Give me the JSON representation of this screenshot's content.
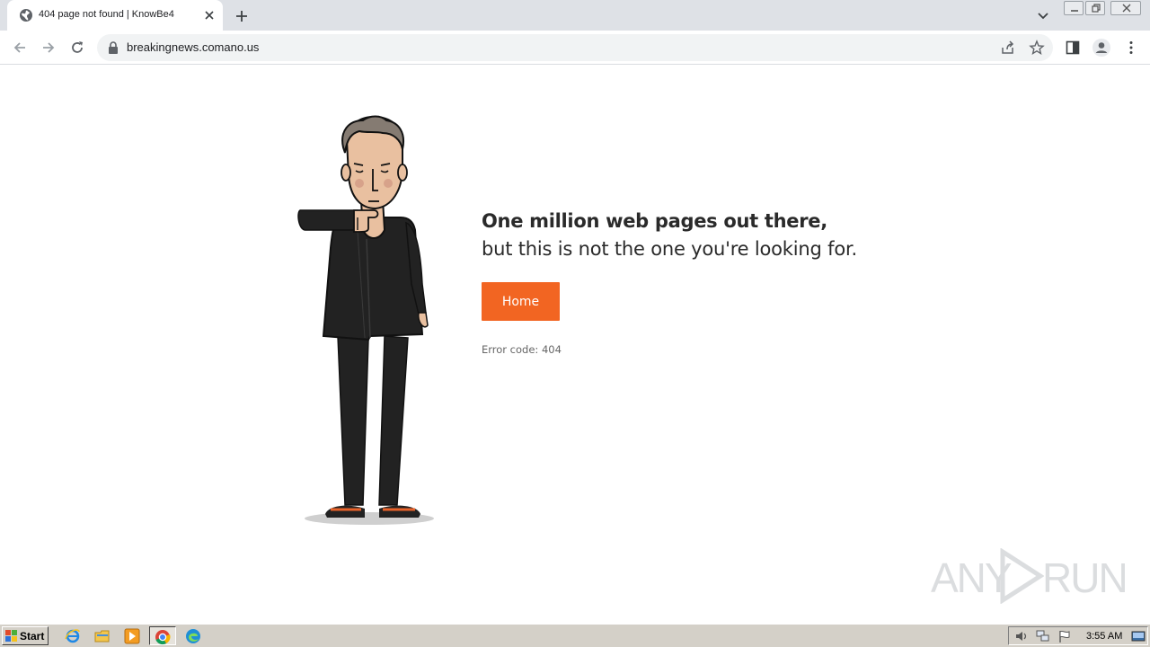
{
  "browser": {
    "tab": {
      "title": "404 page not found | KnowBe4"
    },
    "address": {
      "url": "breakingnews.comano.us"
    }
  },
  "page": {
    "headline": "One million web pages out there,",
    "subline": "but this is not the one you're looking for.",
    "home_button": "Home",
    "error_code": "Error code: 404"
  },
  "watermark": {
    "left": "ANY",
    "right": "RUN"
  },
  "taskbar": {
    "start_label": "Start",
    "clock": "3:55 AM"
  },
  "colors": {
    "accent": "#f26522",
    "tabstrip": "#dee1e6",
    "taskbar": "#d4d0c8"
  }
}
